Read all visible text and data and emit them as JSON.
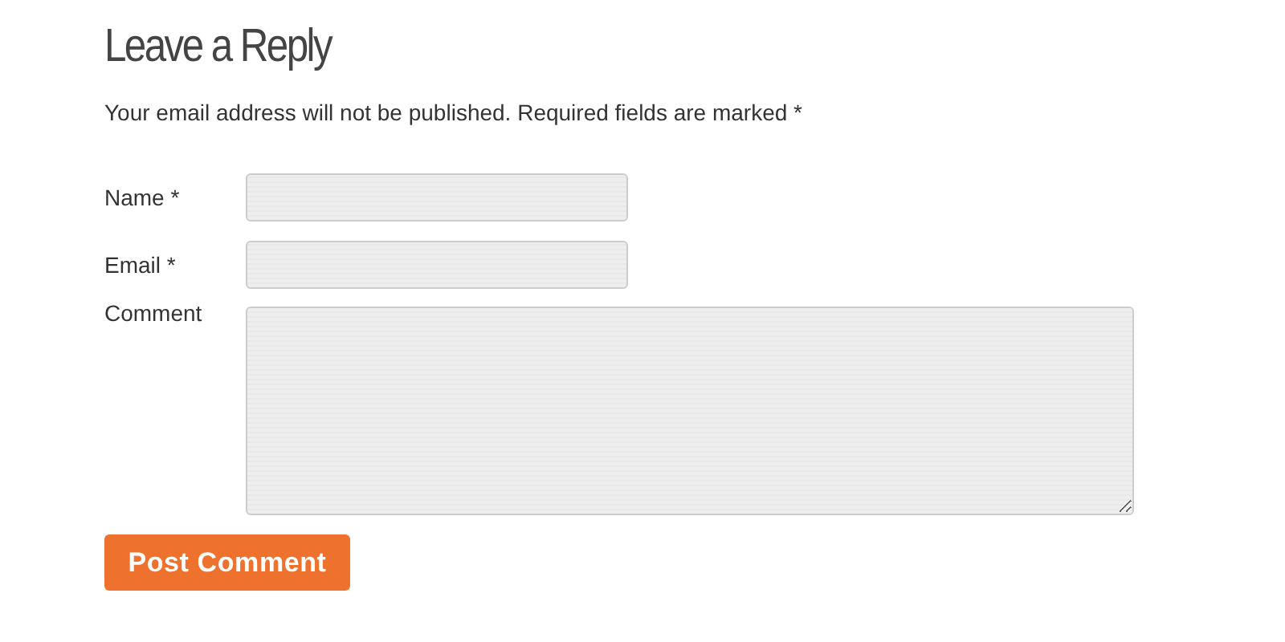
{
  "heading": "Leave a Reply",
  "notice": "Your email address will not be published. Required fields are marked *",
  "fields": [
    {
      "label": "Name *",
      "kind": "input"
    },
    {
      "label": "Email *",
      "kind": "input"
    },
    {
      "label": "Comment",
      "kind": "textarea"
    }
  ],
  "submit": "Post Comment"
}
